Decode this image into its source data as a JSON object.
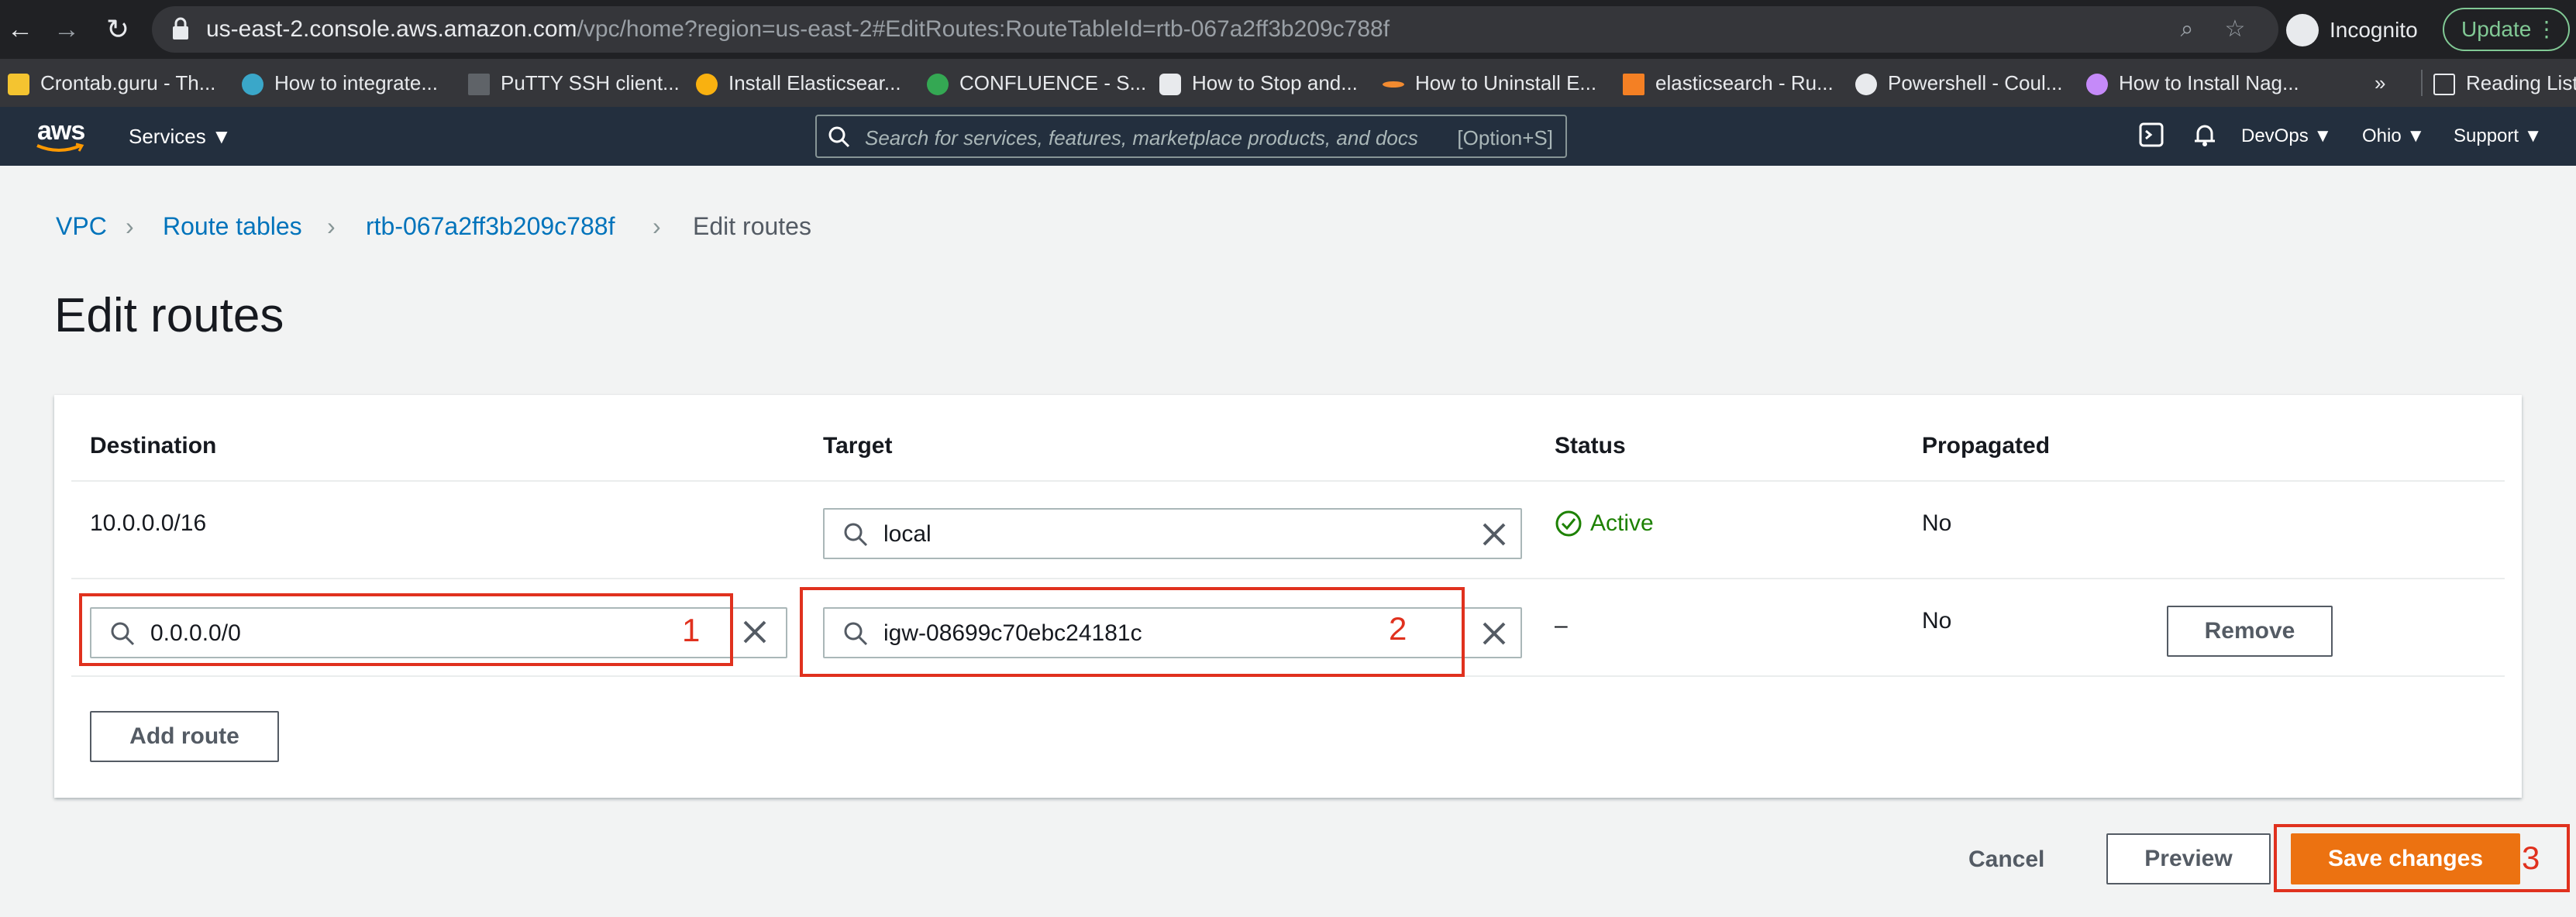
{
  "browser": {
    "url_host": "us-east-2.console.aws.amazon.com",
    "url_path": "/vpc/home?region=us-east-2#EditRoutes:RouteTableId=rtb-067a2ff3b209c788f",
    "profile_label": "Incognito",
    "update_label": "Update",
    "bookmarks": [
      {
        "label": "Crontab.guru - Th...",
        "icon": "crontab-icon",
        "color": "#f4c430"
      },
      {
        "label": "How to integrate...",
        "icon": "eye-icon",
        "color": "#3aa7c9"
      },
      {
        "label": "PuTTY SSH client...",
        "icon": "putty-icon",
        "color": "#9aa0a6"
      },
      {
        "label": "Install Elasticsear...",
        "icon": "elastic-icon",
        "color": "#f9b110"
      },
      {
        "label": "CONFLUENCE - S...",
        "icon": "confluence-icon",
        "color": "#34a853"
      },
      {
        "label": "How to Stop and...",
        "icon": "cube-icon",
        "color": "#e8eaed"
      },
      {
        "label": "How to Uninstall E...",
        "icon": "swoosh-icon",
        "color": "#f28b30"
      },
      {
        "label": "elasticsearch - Ru...",
        "icon": "stackoverflow-icon",
        "color": "#f48024"
      },
      {
        "label": "Powershell - Coul...",
        "icon": "s-icon",
        "color": "#e8eaed"
      },
      {
        "label": "How to Install Nag...",
        "icon": "avatar-icon",
        "color": "#c58af9"
      }
    ],
    "more_label": "»",
    "reading_list_label": "Reading List"
  },
  "aws": {
    "logo_text": "aws",
    "services_label": "Services",
    "search_placeholder": "Search for services, features, marketplace products, and docs",
    "search_shortcut": "[Option+S]",
    "account_label": "DevOps",
    "region_label": "Ohio",
    "support_label": "Support"
  },
  "breadcrumb": [
    "VPC",
    "Route tables",
    "rtb-067a2ff3b209c788f",
    "Edit routes"
  ],
  "page_title": "Edit routes",
  "table": {
    "headers": [
      "Destination",
      "Target",
      "Status",
      "Propagated"
    ],
    "rows": [
      {
        "destination": "10.0.0.0/16",
        "target": "local",
        "status": "Active",
        "propagated": "No"
      },
      {
        "destination": "0.0.0.0/0",
        "target": "igw-08699c70ebc24181c",
        "status": "–",
        "propagated": "No",
        "remove_label": "Remove"
      }
    ]
  },
  "add_route_label": "Add route",
  "annotations": [
    "1",
    "2",
    "3"
  ],
  "footer": {
    "cancel_label": "Cancel",
    "preview_label": "Preview",
    "save_label": "Save changes"
  },
  "colors": {
    "aws_nav": "#232f3e",
    "link": "#0073bb",
    "primary": "#ec7211",
    "active": "#1d8102",
    "annotation": "#e0311e"
  }
}
